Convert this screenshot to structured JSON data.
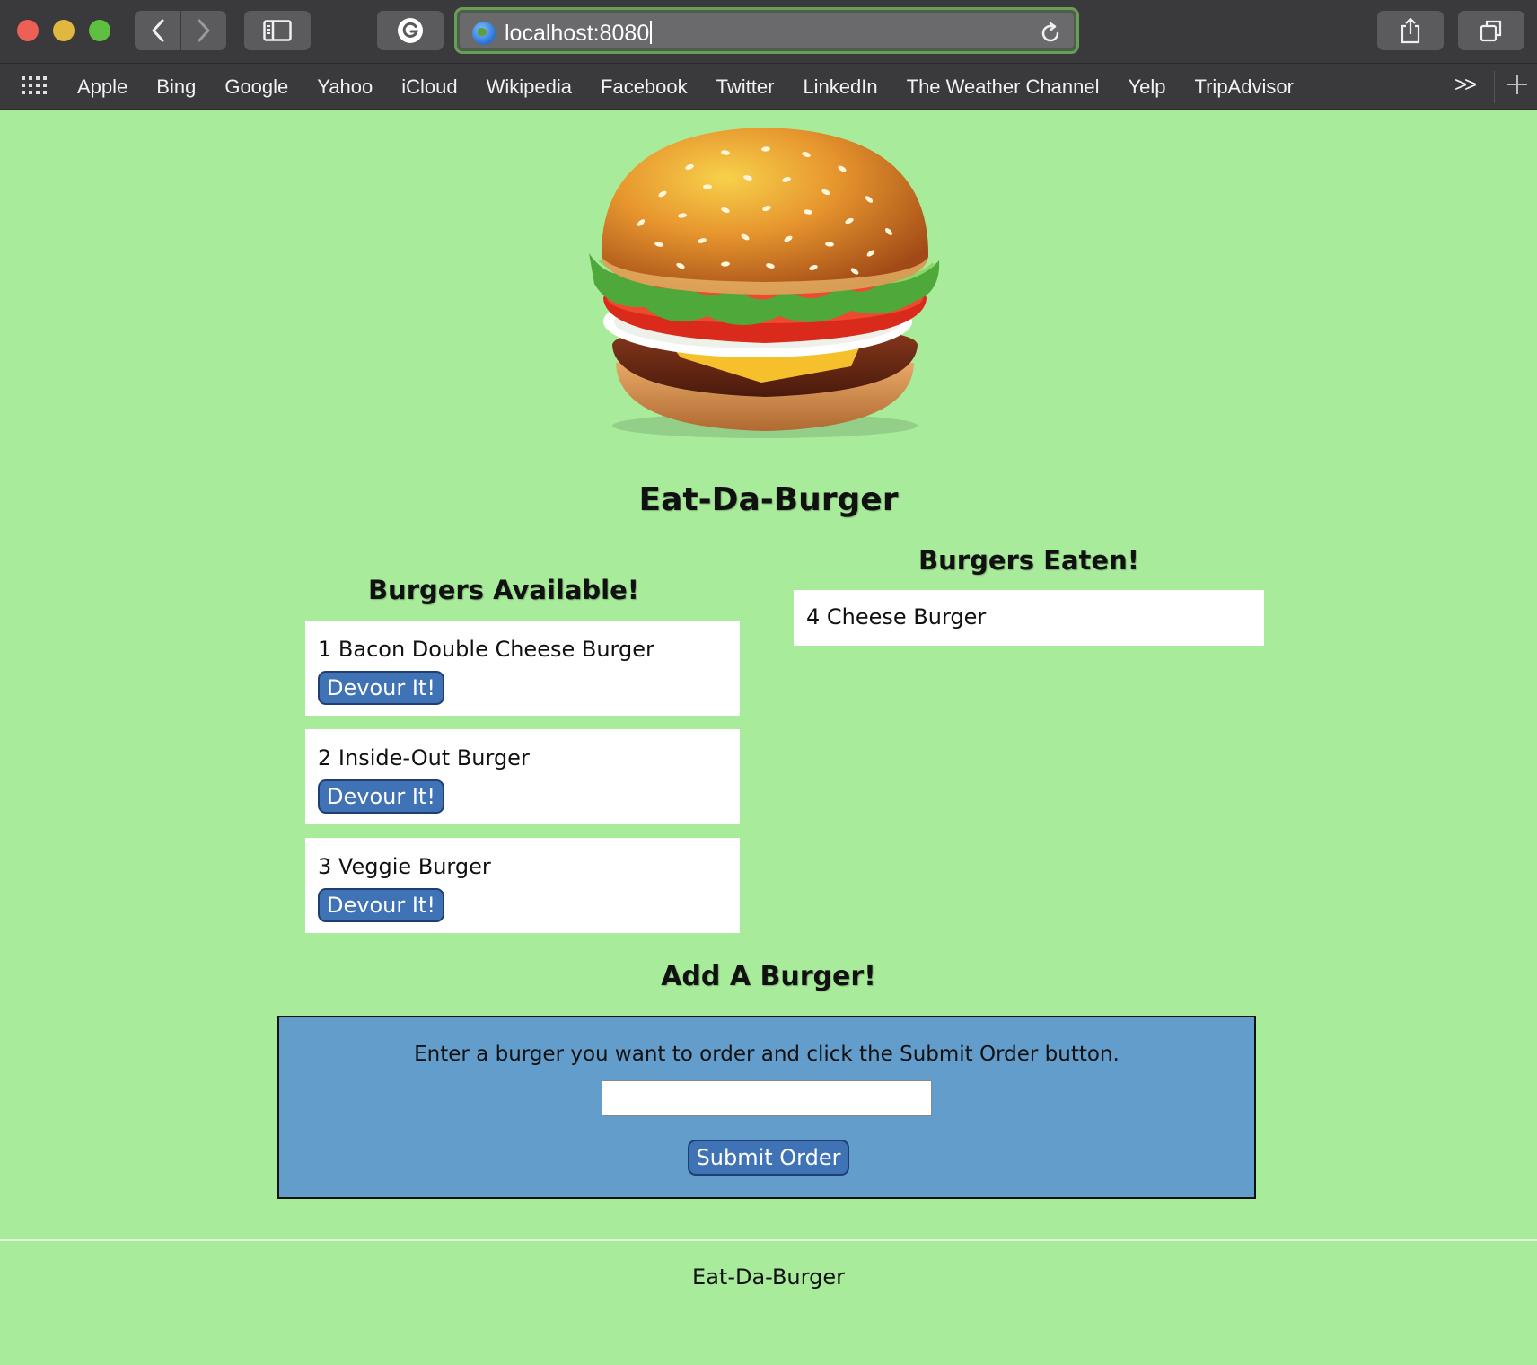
{
  "browser": {
    "url": "localhost:8080",
    "bookmarks": [
      "Apple",
      "Bing",
      "Google",
      "Yahoo",
      "iCloud",
      "Wikipedia",
      "Facebook",
      "Twitter",
      "LinkedIn",
      "The Weather Channel",
      "Yelp",
      "TripAdvisor"
    ],
    "overflow_label": ">>"
  },
  "page": {
    "title": "Eat-Da-Burger",
    "available_heading": "Burgers Available!",
    "eaten_heading": "Burgers Eaten!",
    "available": [
      {
        "label": "1 Bacon Double Cheese Burger",
        "button": "Devour It!"
      },
      {
        "label": "2 Inside-Out Burger",
        "button": "Devour It!"
      },
      {
        "label": "3 Veggie Burger",
        "button": "Devour It!"
      }
    ],
    "eaten": [
      {
        "label": "4 Cheese Burger"
      }
    ],
    "add_heading": "Add A Burger!",
    "form": {
      "instructions": "Enter a burger you want to order and click the Submit Order button.",
      "input_value": "",
      "submit_label": "Submit Order"
    },
    "footer": "Eat-Da-Burger"
  },
  "colors": {
    "background": "#a8ec9b",
    "button": "#3f73b5",
    "form_panel": "#629dcb"
  }
}
